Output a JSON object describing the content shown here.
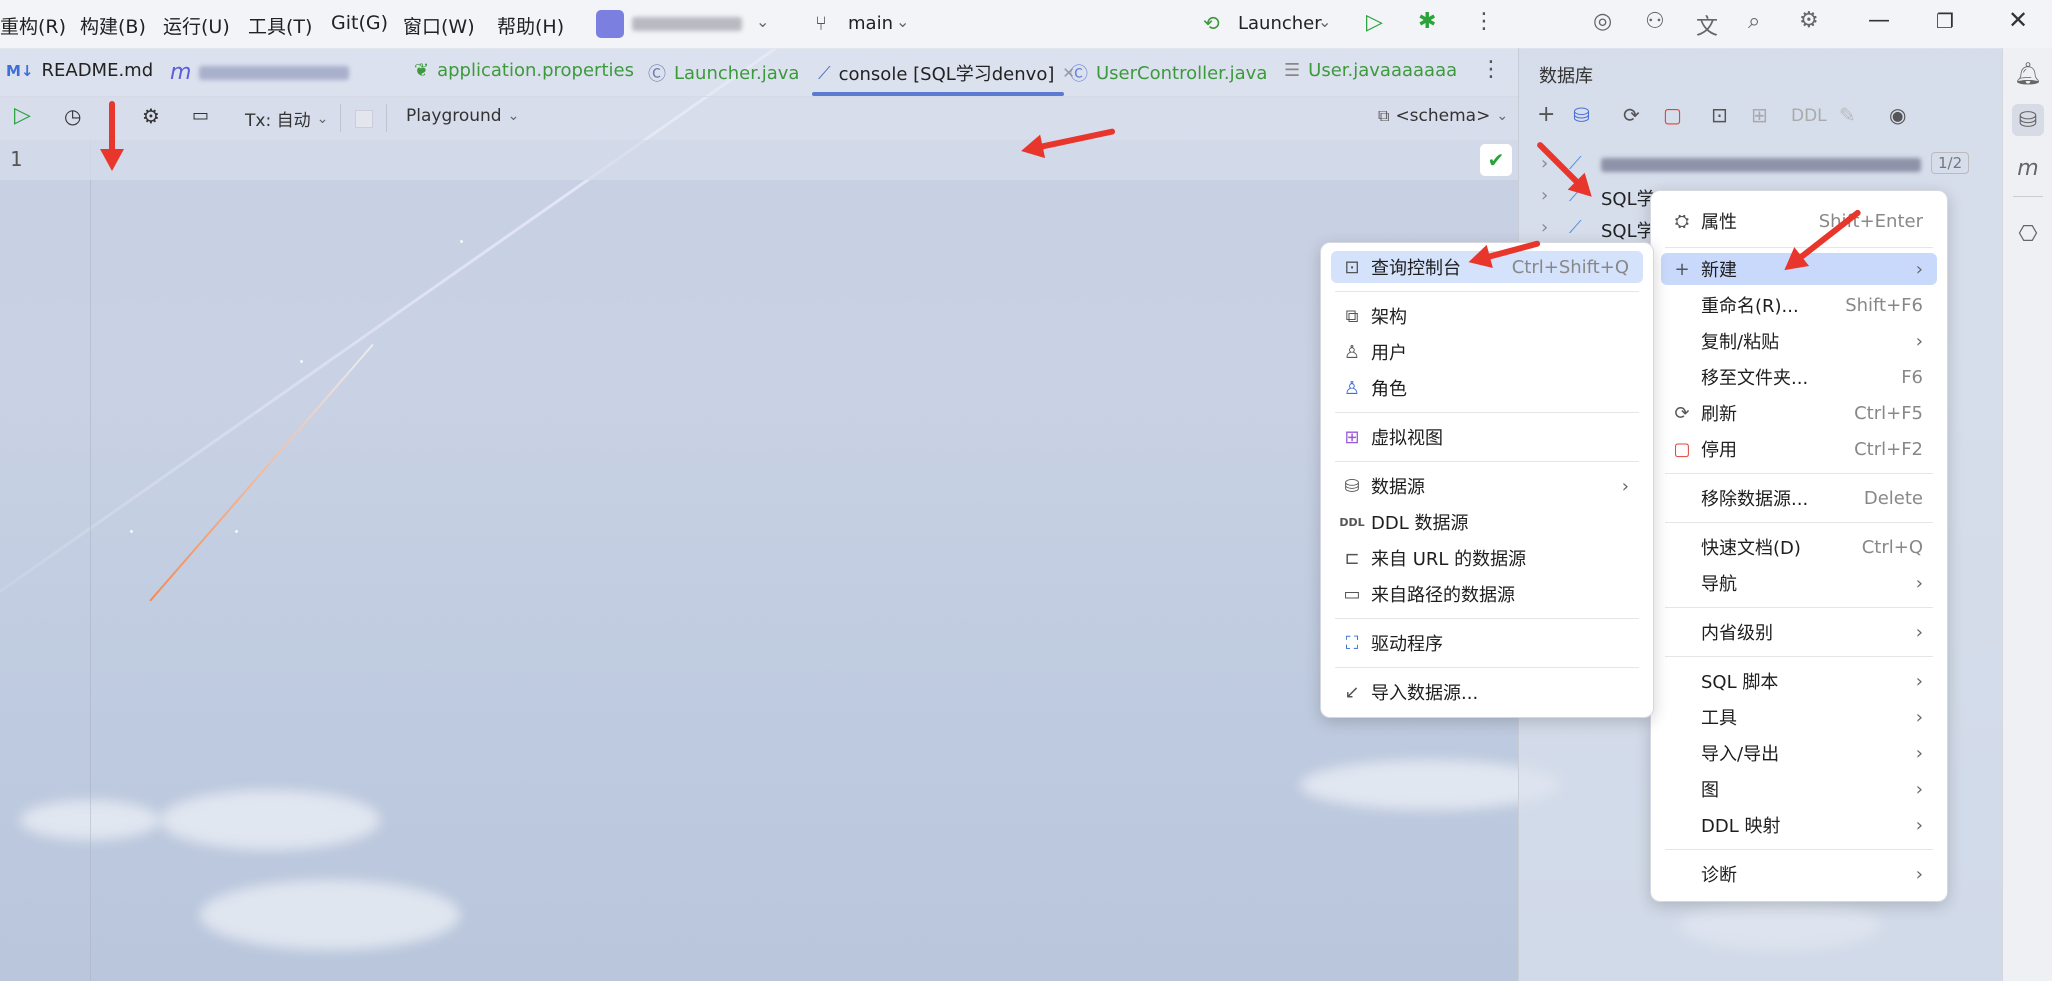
{
  "menubar": {
    "items": [
      "重构(R)",
      "构建(B)",
      "运行(U)",
      "工具(T)",
      "Git(G)",
      "窗口(W)",
      "帮助(H)"
    ],
    "branch": "main",
    "run_config": "Launcher"
  },
  "tabs": [
    {
      "label": "README.md",
      "icon": "markdown-icon",
      "color": "#333333"
    },
    {
      "label": "",
      "icon": "m-icon",
      "color": "#555555"
    },
    {
      "label": "application.properties",
      "icon": "spring-leaf-icon",
      "color": "#3c9a3c"
    },
    {
      "label": "Launcher.java",
      "icon": "java-class-icon",
      "color": "#3c9a3c"
    },
    {
      "label": "console [SQL学习denvo]",
      "icon": "console-icon",
      "color": "#222222"
    },
    {
      "label": "UserController.java",
      "icon": "class-c-icon",
      "color": "#3c9a3c"
    },
    {
      "label": "User.javaaaaaaa",
      "icon": "file-lines-icon",
      "color": "#3c9a3c"
    }
  ],
  "editor_toolbar": {
    "tx_label": "Tx: 自动",
    "playground": "Playground",
    "schema": "<schema>"
  },
  "editor": {
    "line_number": "1"
  },
  "db_panel": {
    "title": "数据库",
    "ddl_label": "DDL",
    "page": "1/2",
    "tree_items": [
      "SQL学习",
      "SQL学"
    ]
  },
  "context_menu": {
    "items": [
      {
        "label": "属性",
        "shortcut": "Shift+Enter",
        "icon": "properties-icon"
      },
      {
        "label": "新建",
        "shortcut": "",
        "icon": "plus-icon",
        "submenu": true
      },
      {
        "label": "重命名(R)...",
        "shortcut": "Shift+F6",
        "icon": ""
      },
      {
        "label": "复制/粘贴",
        "shortcut": "",
        "icon": "",
        "submenu": true
      },
      {
        "label": "移至文件夹...",
        "shortcut": "F6",
        "icon": ""
      },
      {
        "label": "刷新",
        "shortcut": "Ctrl+F5",
        "icon": "refresh-icon"
      },
      {
        "label": "停用",
        "shortcut": "Ctrl+F2",
        "icon": "disconnect-icon"
      },
      {
        "label": "移除数据源...",
        "shortcut": "Delete",
        "icon": ""
      },
      {
        "label": "快速文档(D)",
        "shortcut": "Ctrl+Q",
        "icon": ""
      },
      {
        "label": "导航",
        "shortcut": "",
        "icon": "",
        "submenu": true
      },
      {
        "label": "内省级别",
        "shortcut": "",
        "icon": "",
        "submenu": true
      },
      {
        "label": "SQL 脚本",
        "shortcut": "",
        "icon": "",
        "submenu": true
      },
      {
        "label": "工具",
        "shortcut": "",
        "icon": "",
        "submenu": true
      },
      {
        "label": "导入/导出",
        "shortcut": "",
        "icon": "",
        "submenu": true
      },
      {
        "label": "图",
        "shortcut": "",
        "icon": "",
        "submenu": true
      },
      {
        "label": "DDL 映射",
        "shortcut": "",
        "icon": "",
        "submenu": true
      },
      {
        "label": "诊断",
        "shortcut": "",
        "icon": "",
        "submenu": true
      }
    ]
  },
  "submenu": {
    "items": [
      {
        "label": "查询控制台",
        "shortcut": "Ctrl+Shift+Q",
        "icon": "console-icon"
      },
      {
        "label": "架构",
        "shortcut": "",
        "icon": "schema-icon"
      },
      {
        "label": "用户",
        "shortcut": "",
        "icon": "user-icon"
      },
      {
        "label": "角色",
        "shortcut": "",
        "icon": "role-icon"
      },
      {
        "label": "虚拟视图",
        "shortcut": "",
        "icon": "virtual-view-icon"
      },
      {
        "label": "数据源",
        "shortcut": "",
        "icon": "database-icon",
        "submenu": true
      },
      {
        "label": "DDL 数据源",
        "shortcut": "",
        "icon": "ddl-icon"
      },
      {
        "label": "来自 URL 的数据源",
        "shortcut": "",
        "icon": "plug-icon"
      },
      {
        "label": "来自路径的数据源",
        "shortcut": "",
        "icon": "folder-icon"
      },
      {
        "label": "驱动程序",
        "shortcut": "",
        "icon": "driver-icon"
      },
      {
        "label": "导入数据源...",
        "shortcut": "",
        "icon": "import-icon"
      }
    ]
  },
  "colors": {
    "accent_green": "#3c9a3c",
    "selection_blue": "#d5e2fb",
    "annotation_red": "#e8362c"
  }
}
